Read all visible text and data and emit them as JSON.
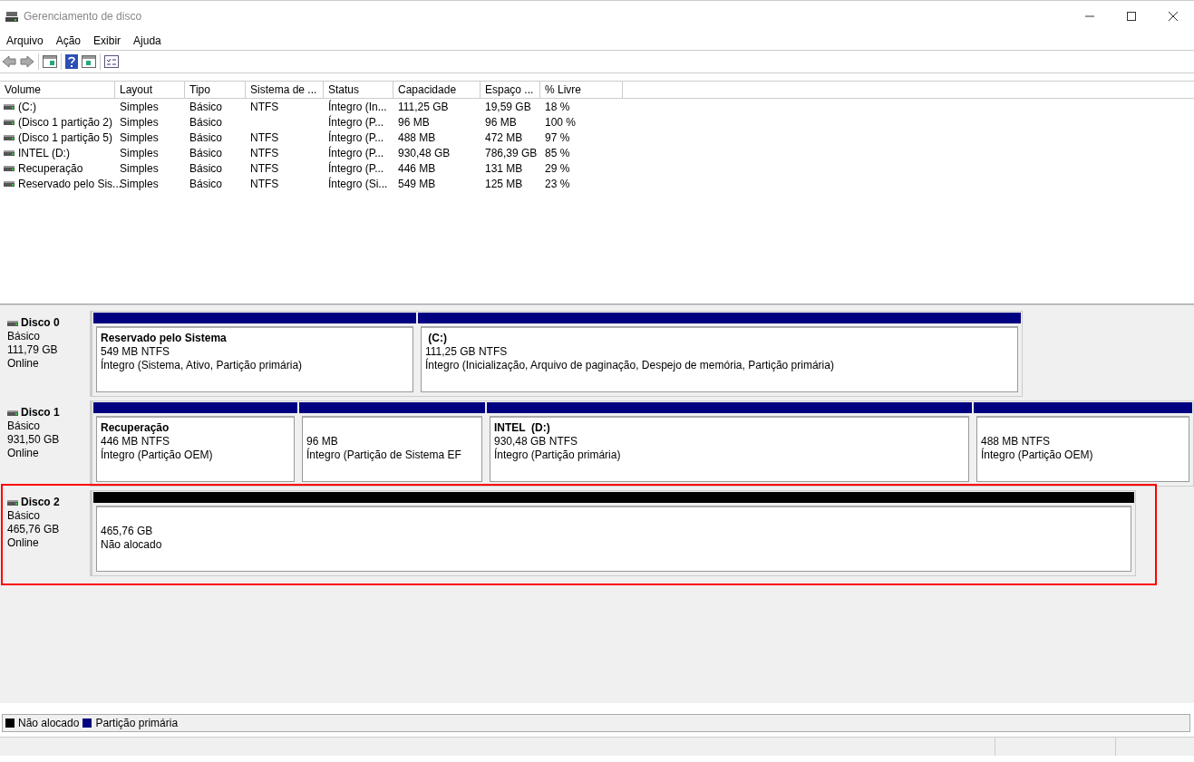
{
  "window": {
    "title": "Gerenciamento de disco"
  },
  "menu": [
    "Arquivo",
    "Ação",
    "Exibir",
    "Ajuda"
  ],
  "table": {
    "columns": [
      "Volume",
      "Layout",
      "Tipo",
      "Sistema de ...",
      "Status",
      "Capacidade",
      "Espaço ...",
      "% Livre"
    ],
    "rows": [
      [
        "(C:)",
        "Simples",
        "Básico",
        "NTFS",
        "Íntegro (In...",
        "111,25 GB",
        "19,59 GB",
        "18 %"
      ],
      [
        "(Disco 1 partição 2)",
        "Simples",
        "Básico",
        "",
        "Íntegro (P...",
        "96 MB",
        "96 MB",
        "100 %"
      ],
      [
        "(Disco 1 partição 5)",
        "Simples",
        "Básico",
        "NTFS",
        "Íntegro (P...",
        "488 MB",
        "472 MB",
        "97 %"
      ],
      [
        "INTEL (D:)",
        "Simples",
        "Básico",
        "NTFS",
        "Íntegro (P...",
        "930,48 GB",
        "786,39 GB",
        "85 %"
      ],
      [
        "Recuperação",
        "Simples",
        "Básico",
        "NTFS",
        "Íntegro (P...",
        "446 MB",
        "131 MB",
        "29 %"
      ],
      [
        "Reservado pelo Sis...",
        "Simples",
        "Básico",
        "NTFS",
        "Íntegro (Si...",
        "549 MB",
        "125 MB",
        "23 %"
      ]
    ]
  },
  "disks": [
    {
      "name": "Disco 0",
      "type": "Básico",
      "size": "111,79 GB",
      "status": "Online",
      "highlighted": false,
      "partitions": [
        {
          "title": "Reservado pelo Sistema",
          "size": "549 MB NTFS",
          "status": "Íntegro (Sistema, Ativo, Partição primária)",
          "color": "#000080"
        },
        {
          "title": " (C:)",
          "size": "111,25 GB NTFS",
          "status": "Íntegro (Inicialização, Arquivo de paginação, Despejo de memória, Partição primária)",
          "color": "#000080"
        }
      ]
    },
    {
      "name": "Disco 1",
      "type": "Básico",
      "size": "931,50 GB",
      "status": "Online",
      "highlighted": false,
      "partitions": [
        {
          "title": "Recuperação",
          "size": "446 MB NTFS",
          "status": "Íntegro (Partição OEM)",
          "color": "#000080"
        },
        {
          "size": "96 MB",
          "status": "Íntegro (Partição de Sistema EF",
          "color": "#000080"
        },
        {
          "title": "INTEL  (D:)",
          "size": "930,48 GB NTFS",
          "status": "Íntegro (Partição primária)",
          "color": "#000080"
        },
        {
          "size": "488 MB NTFS",
          "status": "Íntegro (Partição OEM)",
          "color": "#000080"
        }
      ]
    },
    {
      "name": "Disco 2",
      "type": "Básico",
      "size": "465,76 GB",
      "status": "Online",
      "highlighted": true,
      "partitions": [
        {
          "size": "465,76 GB",
          "status": "Não alocado",
          "color": "#000000"
        }
      ]
    }
  ],
  "legend": [
    {
      "label": "Não alocado",
      "color": "#000000"
    },
    {
      "label": "Partição primária",
      "color": "#000080"
    }
  ]
}
